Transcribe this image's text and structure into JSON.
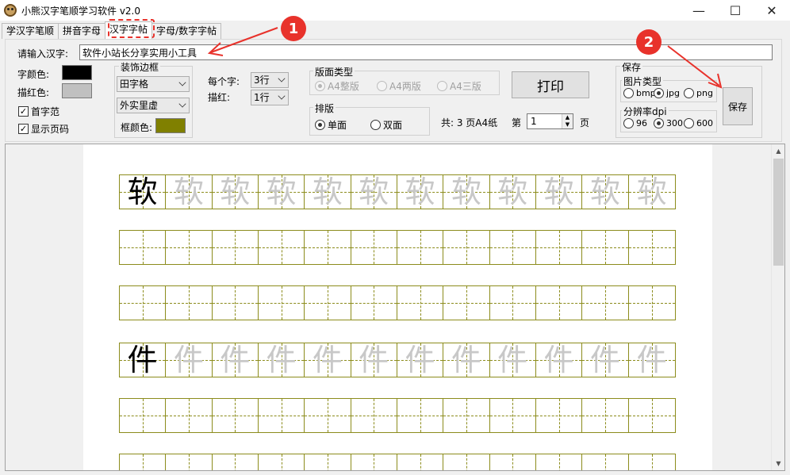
{
  "window": {
    "title": "小熊汉字笔顺学习软件 v2.0",
    "minimize": "—",
    "maximize": "☐",
    "close": "✕"
  },
  "tabs": [
    {
      "label": "学汉字笔顺",
      "active": false
    },
    {
      "label": "拼音字母",
      "active": false
    },
    {
      "label": "汉字字帖",
      "active": true
    },
    {
      "label": "字母/数字字帖",
      "active": false
    }
  ],
  "annotations": {
    "marker1": "1",
    "marker2": "2",
    "color": "#e8322b"
  },
  "input": {
    "label": "请输入汉字:",
    "value": "软件小站长分享实用小工具"
  },
  "colors": {
    "font_color_label": "字颜色:",
    "font_color": "#000000",
    "trace_color_label": "描红色:",
    "trace_color": "#c0c0c0",
    "first_char_model": "首字范",
    "first_char_model_checked": true,
    "show_page_number": "显示页码",
    "show_page_number_checked": true
  },
  "border": {
    "group_title": "装饰边框",
    "grid_type": "田字格",
    "line_style": "外实里虚",
    "frame_color_label": "框颜色:",
    "frame_color": "#808000"
  },
  "layout_opts": {
    "per_char_label": "每个字:",
    "per_char_value": "3行",
    "trace_label": "描红:",
    "trace_value": "1行"
  },
  "page_type": {
    "group_title": "版面类型",
    "options": [
      {
        "label": "A4整版",
        "selected": true
      },
      {
        "label": "A4两版",
        "selected": false
      },
      {
        "label": "A4三版",
        "selected": false
      }
    ]
  },
  "typeset": {
    "group_title": "排版",
    "options": [
      {
        "label": "单面",
        "selected": true
      },
      {
        "label": "双面",
        "selected": false
      }
    ]
  },
  "print": {
    "button": "打印",
    "total": "共: 3 页A4纸",
    "page_prefix": "第",
    "page_value": "1",
    "page_suffix": "页"
  },
  "save": {
    "group_title": "保存",
    "image_type_title": "图片类型",
    "image_types": [
      {
        "label": "bmp",
        "selected": false
      },
      {
        "label": "jpg",
        "selected": true
      },
      {
        "label": "png",
        "selected": false
      }
    ],
    "dpi_title": "分辨率dpi",
    "dpis": [
      {
        "label": "96",
        "selected": false
      },
      {
        "label": "300",
        "selected": true
      },
      {
        "label": "600",
        "selected": false
      }
    ],
    "button": "保存"
  },
  "preview": {
    "rows": [
      {
        "char": "软",
        "type": "char"
      },
      {
        "char": "",
        "type": "empty"
      },
      {
        "char": "",
        "type": "empty"
      },
      {
        "char": "件",
        "type": "char"
      },
      {
        "char": "",
        "type": "empty"
      },
      {
        "char": "",
        "type": "empty"
      }
    ],
    "cells_per_row": 12,
    "grid_color": "#8c8c1c"
  }
}
